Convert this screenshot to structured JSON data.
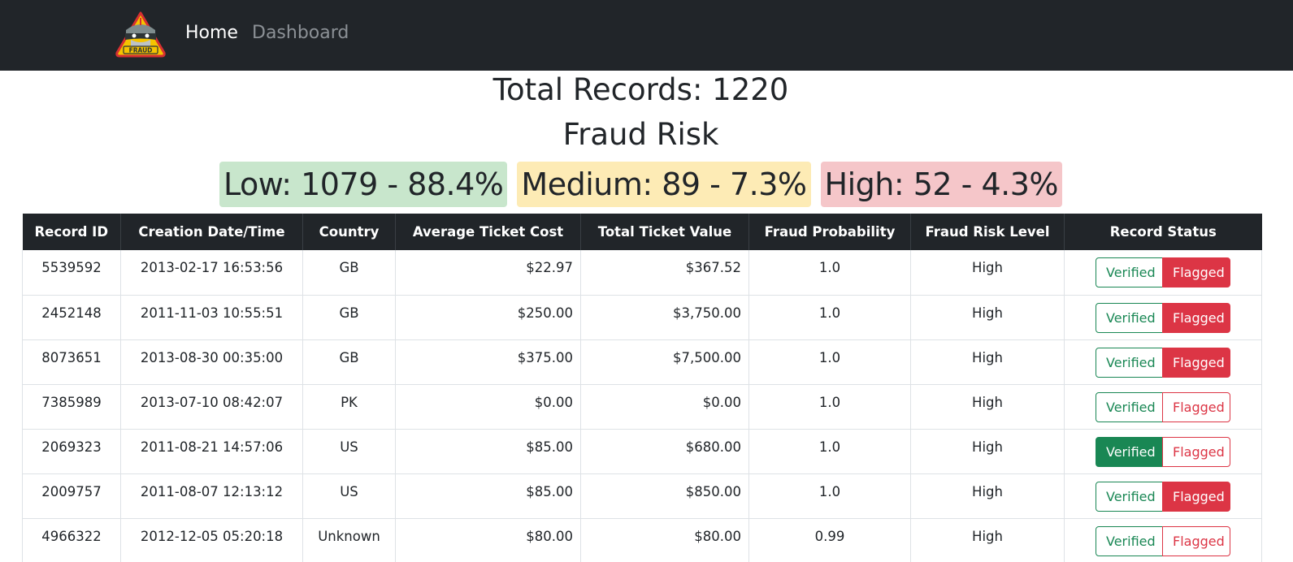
{
  "nav": {
    "logo_text": "FRAUD",
    "home": "Home",
    "dashboard": "Dashboard"
  },
  "summary": {
    "total": "Total Records: 1220",
    "risk_title": "Fraud Risk",
    "low": "Low: 1079 - 88.4%",
    "medium": "Medium: 89 - 7.3%",
    "high": "High: 52 - 4.3%"
  },
  "colors": {
    "verified": "#198754",
    "flagged": "#dc3545",
    "navbar": "#212529"
  },
  "table": {
    "headers": [
      "Record ID",
      "Creation Date/Time",
      "Country",
      "Average Ticket Cost",
      "Total Ticket Value",
      "Fraud Probability",
      "Fraud Risk Level",
      "Record Status"
    ],
    "verified_label": "Verified",
    "flagged_label": "Flagged",
    "rows": [
      {
        "id": "5539592",
        "date": "2013-02-17 16:53:56",
        "country": "GB",
        "avg": "$22.97",
        "total": "$367.52",
        "prob": "1.0",
        "level": "High",
        "status": "flagged"
      },
      {
        "id": "2452148",
        "date": "2011-11-03 10:55:51",
        "country": "GB",
        "avg": "$250.00",
        "total": "$3,750.00",
        "prob": "1.0",
        "level": "High",
        "status": "flagged"
      },
      {
        "id": "8073651",
        "date": "2013-08-30 00:35:00",
        "country": "GB",
        "avg": "$375.00",
        "total": "$7,500.00",
        "prob": "1.0",
        "level": "High",
        "status": "flagged"
      },
      {
        "id": "7385989",
        "date": "2013-07-10 08:42:07",
        "country": "PK",
        "avg": "$0.00",
        "total": "$0.00",
        "prob": "1.0",
        "level": "High",
        "status": "none"
      },
      {
        "id": "2069323",
        "date": "2011-08-21 14:57:06",
        "country": "US",
        "avg": "$85.00",
        "total": "$680.00",
        "prob": "1.0",
        "level": "High",
        "status": "verified"
      },
      {
        "id": "2009757",
        "date": "2011-08-07 12:13:12",
        "country": "US",
        "avg": "$85.00",
        "total": "$850.00",
        "prob": "1.0",
        "level": "High",
        "status": "flagged"
      },
      {
        "id": "4966322",
        "date": "2012-12-05 05:20:18",
        "country": "Unknown",
        "avg": "$80.00",
        "total": "$80.00",
        "prob": "0.99",
        "level": "High",
        "status": "none"
      }
    ]
  }
}
